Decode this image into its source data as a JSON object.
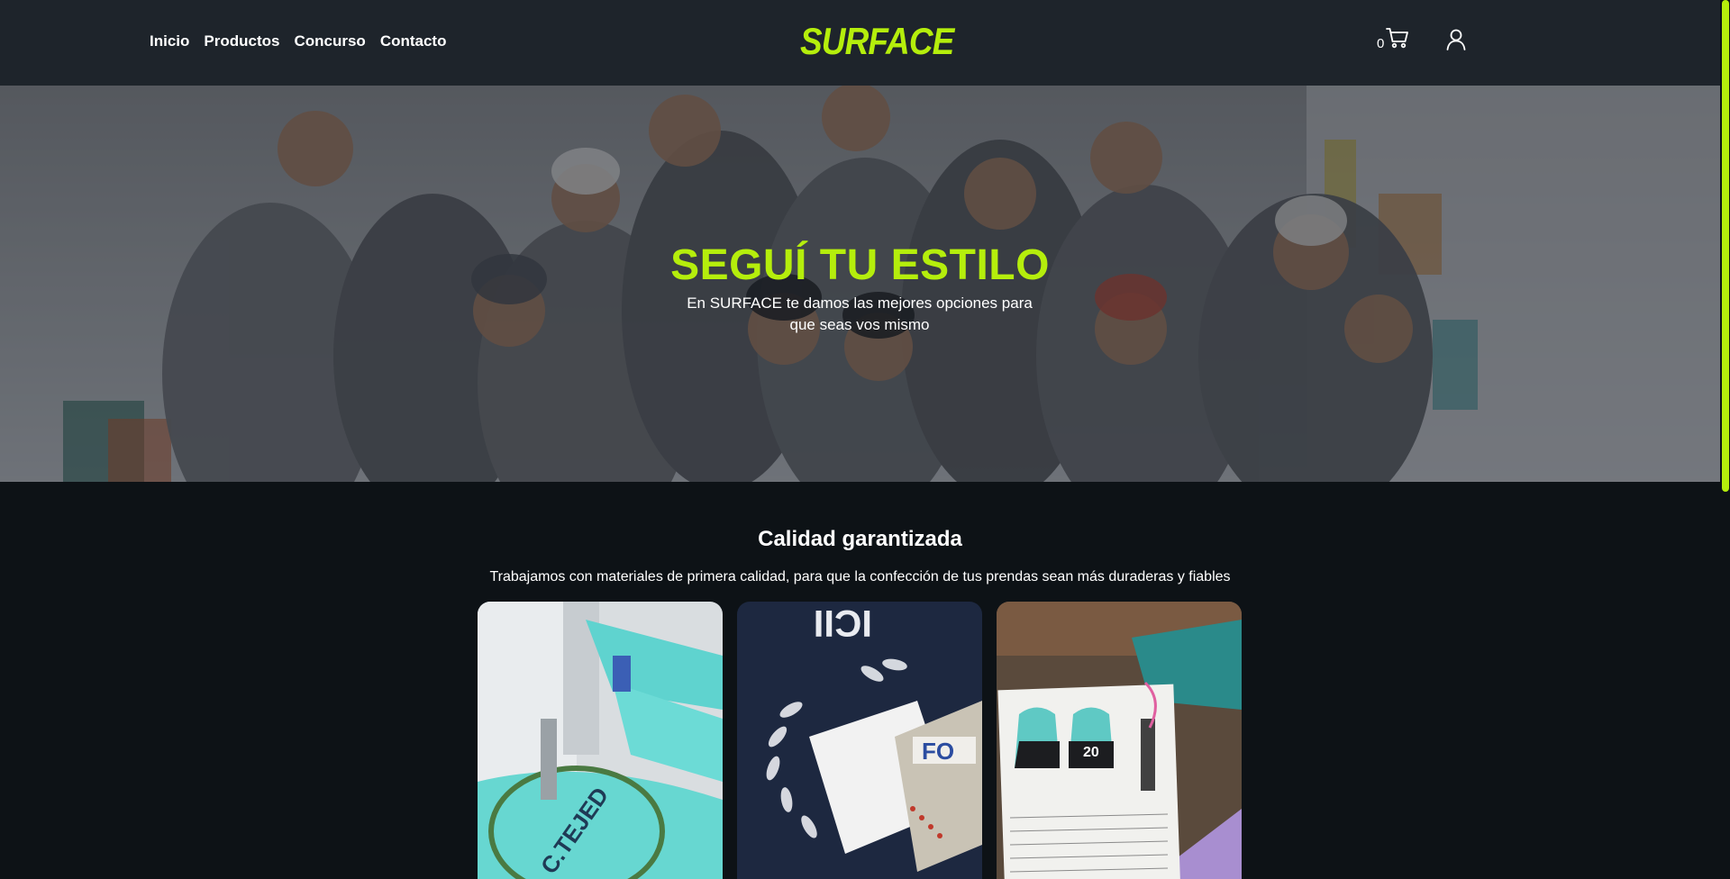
{
  "header": {
    "nav": [
      "Inicio",
      "Productos",
      "Concurso",
      "Contacto"
    ],
    "logo": "SURFACE",
    "cart_count": "0",
    "cart_icon": "shopping-cart-icon",
    "user_icon": "user-icon"
  },
  "hero": {
    "title": "SEGUÍ TU ESTILO",
    "subtitle": "En SURFACE te damos las mejores opciones para que seas vos mismo"
  },
  "quality": {
    "title": "Calidad garantizada",
    "text": "Trabajamos con materiales de primera calidad, para que la confección de tus prendas sean más duraderas y fiables"
  },
  "colors": {
    "accent": "#b5ee0c",
    "header_bg": "#1e242b",
    "page_bg": "#0d1216"
  }
}
